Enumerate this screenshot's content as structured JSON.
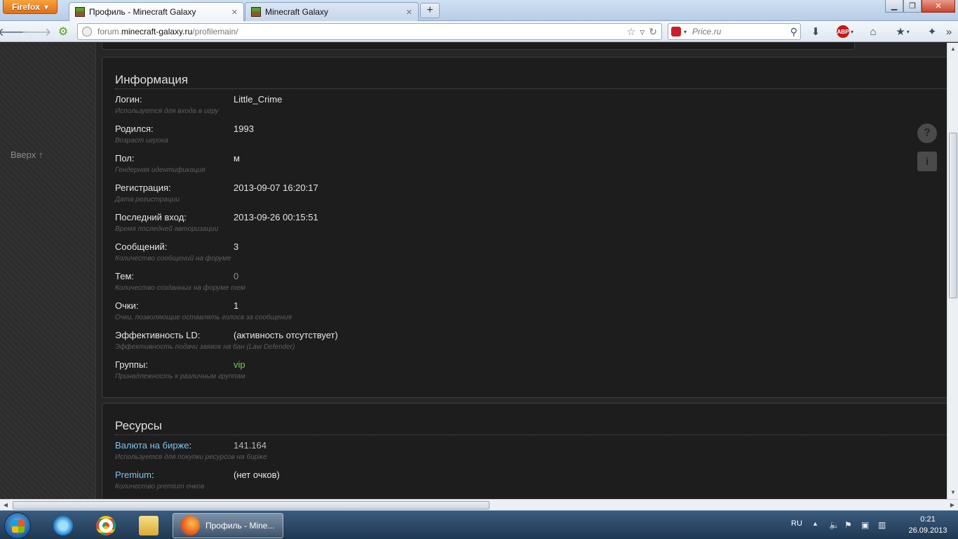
{
  "browser": {
    "menu_button": "Firefox",
    "tabs": [
      {
        "title": "Профиль - Minecraft Galaxy",
        "close": "✕"
      },
      {
        "title": "Minecraft Galaxy",
        "close": "✕"
      }
    ],
    "new_tab": "+",
    "url": {
      "pre": "forum.",
      "domain": "minecraft-galaxy.ru",
      "path": "/profilemain/"
    },
    "search_placeholder": "Price.ru"
  },
  "page": {
    "back_to_top": "Вверх ↑",
    "info": {
      "title": "Информация",
      "rows": [
        {
          "label": "Логин:",
          "value": "Little_Crime",
          "desc": "Используется для входа в игру"
        },
        {
          "label": "Родился:",
          "value": "1993",
          "desc": "Возраст игрока"
        },
        {
          "label": "Пол:",
          "value": "м",
          "desc": "Гендерная идентификация"
        },
        {
          "label": "Регистрация:",
          "value": "2013-09-07 16:20:17",
          "desc": "Дата регистрации"
        },
        {
          "label": "Последний вход:",
          "value": "2013-09-26 00:15:51",
          "desc": "Время последней авторизации"
        },
        {
          "label": "Сообщений:",
          "value": "3",
          "desc": "Количество сообщений на форуме"
        },
        {
          "label": "Тем:",
          "value": "0",
          "desc": "Количество созданных на форуме тем"
        },
        {
          "label": "Очки:",
          "value": "1",
          "desc": "Очки, позволяющие оставлять голоса за сообщения"
        },
        {
          "label": "Эффективность LD:",
          "value": "(активность отсутствует)",
          "desc": "Эффективность подачи заявок на бан (Law Defender)"
        },
        {
          "label": "Группы:",
          "value": "vip",
          "desc": "Принадлежность к различным группам"
        }
      ]
    },
    "resources": {
      "title": "Ресурсы",
      "rows": [
        {
          "label_link": "Валюта на бирже",
          "label_suffix": ":",
          "value": "141.164",
          "desc": "Используется для покупки ресурсов на бирже"
        },
        {
          "label_link": "Premium",
          "label_suffix": ":",
          "value": "(нет очков)",
          "desc": "Количество premium очков"
        }
      ]
    },
    "side_icons": {
      "help": "?",
      "info": "i"
    }
  },
  "taskbar": {
    "active_window": "Профиль - Mine...",
    "lang": "RU",
    "time": "0:21",
    "date": "26.09.2013"
  }
}
